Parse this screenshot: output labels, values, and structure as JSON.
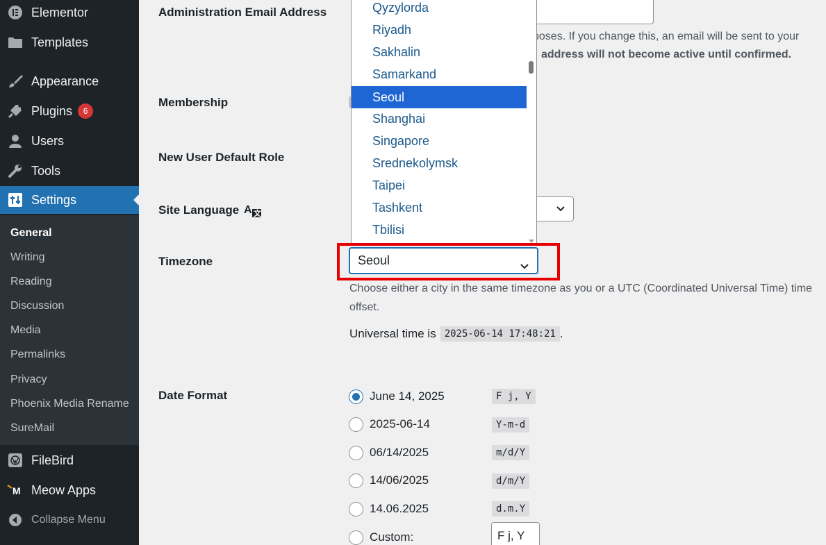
{
  "sidebar": {
    "items": [
      {
        "label": "Elementor",
        "icon": "elementor-icon"
      },
      {
        "label": "Templates",
        "icon": "folder-icon"
      },
      {
        "label": "Appearance",
        "icon": "paintbrush-icon"
      },
      {
        "label": "Plugins",
        "icon": "plug-icon",
        "badge": "6"
      },
      {
        "label": "Users",
        "icon": "user-icon"
      },
      {
        "label": "Tools",
        "icon": "wrench-icon"
      },
      {
        "label": "Settings",
        "icon": "settings-icon"
      },
      {
        "label": "FileBird",
        "icon": "wordpress-icon"
      },
      {
        "label": "Meow Apps",
        "icon": "meow-apps-icon"
      },
      {
        "label": "Collapse Menu",
        "icon": "collapse-icon"
      }
    ],
    "submenu": [
      "General",
      "Writing",
      "Reading",
      "Discussion",
      "Media",
      "Permalinks",
      "Privacy",
      "Phoenix Media Rename",
      "SureMail"
    ]
  },
  "settings": {
    "admin_email_label": "Administration Email Address",
    "admin_email_desc_1": "poses. If you change this, an email will be sent to your",
    "admin_email_desc_2": "address will not become active until confirmed.",
    "membership_label": "Membership",
    "default_role_label": "New User Default Role",
    "site_language_label": "Site Language",
    "timezone_label": "Timezone",
    "timezone_value": "Seoul",
    "timezone_desc": "Choose either a city in the same timezone as you or a UTC (Coordinated Universal Time) time offset.",
    "universal_time_prefix": "Universal time is",
    "universal_time_value": "2025-06-14 17:48:21",
    "universal_time_suffix": ".",
    "date_format_label": "Date Format"
  },
  "timezone_options": [
    "Qyzylorda",
    "Riyadh",
    "Sakhalin",
    "Samarkand",
    "Seoul",
    "Shanghai",
    "Singapore",
    "Srednekolymsk",
    "Taipei",
    "Tashkent",
    "Tbilisi"
  ],
  "date_formats": [
    {
      "label": "June 14, 2025",
      "code": "F j, Y",
      "checked": true
    },
    {
      "label": "2025-06-14",
      "code": "Y-m-d",
      "checked": false
    },
    {
      "label": "06/14/2025",
      "code": "m/d/Y",
      "checked": false
    },
    {
      "label": "14/06/2025",
      "code": "d/m/Y",
      "checked": false
    },
    {
      "label": "14.06.2025",
      "code": "d.m.Y",
      "checked": false
    },
    {
      "label": "Custom:",
      "code": "",
      "checked": false
    }
  ],
  "custom_format_value": "F j, Y",
  "colors": {
    "accent": "#2271b1",
    "highlight_box": "#e60000",
    "badge": "#d63638",
    "selected_option": "#1e66d4"
  }
}
